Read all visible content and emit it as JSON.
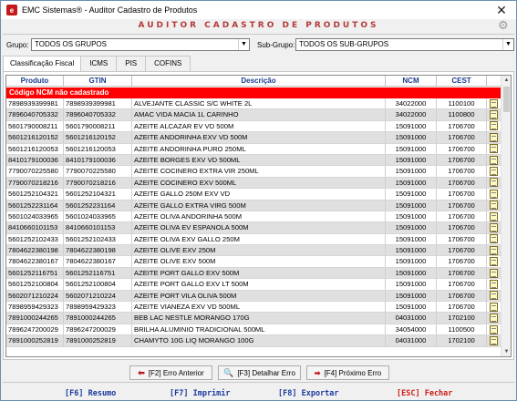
{
  "window": {
    "title": "EMC Sistemas® - Auditor Cadastro de Produtos",
    "close_label": "✕",
    "heading": "AUDITOR CADASTRO DE PRODUTOS"
  },
  "filters": {
    "grupo_label": "Grupo:",
    "grupo_value": "TODOS OS GRUPOS",
    "subgrupo_label": "Sub-Grupo:",
    "subgrupo_value": "TODOS OS SUB-GRUPOS"
  },
  "tabs": [
    {
      "label": "Classificação Fiscal",
      "active": true
    },
    {
      "label": "ICMS"
    },
    {
      "label": "PIS"
    },
    {
      "label": "COFINS"
    }
  ],
  "grid": {
    "columns": [
      "Produto",
      "GTIN",
      "Descrição",
      "NCM",
      "CEST"
    ],
    "group_header": "Código NCM não cadastrado",
    "rows": [
      {
        "produto": "7898939399981",
        "gtin": "7898939399981",
        "descricao": "ALVEJANTE CLASSIC S/C WHITE 2L",
        "ncm": "34022000",
        "cest": "1100100"
      },
      {
        "produto": "7896040705332",
        "gtin": "7896040705332",
        "descricao": "AMAC VIDA MACIA 1L CARINHO",
        "ncm": "34022000",
        "cest": "1100800"
      },
      {
        "produto": "5601790008211",
        "gtin": "5601790008211",
        "descricao": "AZEITE ALCAZAR EV VD 500M",
        "ncm": "15091000",
        "cest": "1706700"
      },
      {
        "produto": "5601216120152",
        "gtin": "5601216120152",
        "descricao": "AZEITE ANDORINHA EXV VD 500M",
        "ncm": "15091000",
        "cest": "1706700"
      },
      {
        "produto": "5601216120053",
        "gtin": "5601216120053",
        "descricao": "AZEITE ANDORINHA PURO 250ML",
        "ncm": "15091000",
        "cest": "1706700"
      },
      {
        "produto": "8410179100036",
        "gtin": "8410179100036",
        "descricao": "AZEITE BORGES EXV VD 500ML",
        "ncm": "15091000",
        "cest": "1706700"
      },
      {
        "produto": "7790070225580",
        "gtin": "7790070225580",
        "descricao": "AZEITE COCINERO EXTRA VIR 250ML",
        "ncm": "15091000",
        "cest": "1706700"
      },
      {
        "produto": "7790070218216",
        "gtin": "7790070218216",
        "descricao": "AZEITE COCINERO EXV 500ML",
        "ncm": "15091000",
        "cest": "1706700"
      },
      {
        "produto": "5601252104321",
        "gtin": "5601252104321",
        "descricao": "AZEITE GALLO 250M EXV VD",
        "ncm": "15091000",
        "cest": "1706700"
      },
      {
        "produto": "5601252231164",
        "gtin": "5601252231164",
        "descricao": "AZEITE GALLO EXTRA VIRG 500M",
        "ncm": "15091000",
        "cest": "1706700"
      },
      {
        "produto": "5601024033965",
        "gtin": "5601024033965",
        "descricao": "AZEITE OLIVA ANDORINHA 500M",
        "ncm": "15091000",
        "cest": "1706700"
      },
      {
        "produto": "8410660101153",
        "gtin": "8410660101153",
        "descricao": "AZEITE OLIVA EV ESPANOLA 500M",
        "ncm": "15091000",
        "cest": "1706700"
      },
      {
        "produto": "5601252102433",
        "gtin": "5601252102433",
        "descricao": "AZEITE OLIVA EXV GALLO 250M",
        "ncm": "15091000",
        "cest": "1706700"
      },
      {
        "produto": "7804622380198",
        "gtin": "7804622380198",
        "descricao": "AZEITE OLIVE EXV 250M",
        "ncm": "15091000",
        "cest": "1706700"
      },
      {
        "produto": "7804622380167",
        "gtin": "7804622380167",
        "descricao": "AZEITE OLIVE EXV 500M",
        "ncm": "15091000",
        "cest": "1706700"
      },
      {
        "produto": "5601252116751",
        "gtin": "5601252116751",
        "descricao": "AZEITE PORT GALLO EXV 500M",
        "ncm": "15091000",
        "cest": "1706700"
      },
      {
        "produto": "5601252100804",
        "gtin": "5601252100804",
        "descricao": "AZEITE PORT GALLO EXV LT 500M",
        "ncm": "15091000",
        "cest": "1706700"
      },
      {
        "produto": "5602071210224",
        "gtin": "5602071210224",
        "descricao": "AZEITE PORT VILA OLIVA 500M",
        "ncm": "15091000",
        "cest": "1706700"
      },
      {
        "produto": "7898959429323",
        "gtin": "7898959429323",
        "descricao": "AZEITE VIANEZA EXV VD 500ML",
        "ncm": "15091000",
        "cest": "1706700"
      },
      {
        "produto": "7891000244265",
        "gtin": "7891000244265",
        "descricao": "BEB LAC NESTLE MORANGO 170G",
        "ncm": "04031000",
        "cest": "1702100"
      },
      {
        "produto": "7896247200029",
        "gtin": "7896247200029",
        "descricao": "BRILHA ALUMINIO TRADICIONAL 500ML",
        "ncm": "34054000",
        "cest": "1100500"
      },
      {
        "produto": "7891000252819",
        "gtin": "7891000252819",
        "descricao": "CHAMYTO 10G LIQ MORANGO 100G",
        "ncm": "04031000",
        "cest": "1702100"
      }
    ]
  },
  "buttons": {
    "prev": "[F2] Erro Anterior",
    "detail": "[F3] Detalhar Erro",
    "next": "[F4] Próximo Erro"
  },
  "footer": {
    "f6": "[F6] Resumo",
    "f7": "[F7] Imprimir",
    "f8": "[F8] Exportar",
    "esc": "[ESC] Fechar"
  },
  "icons": {
    "app": "emc-app-icon",
    "settings": "gear-icon",
    "row_action": "document-edit-icon"
  },
  "colors": {
    "heading": "#b33a3a",
    "group_row": "#ff0000",
    "column_header": "#1a3a8c",
    "fkey": "#1a3aa0",
    "esc": "#d01a1a"
  }
}
